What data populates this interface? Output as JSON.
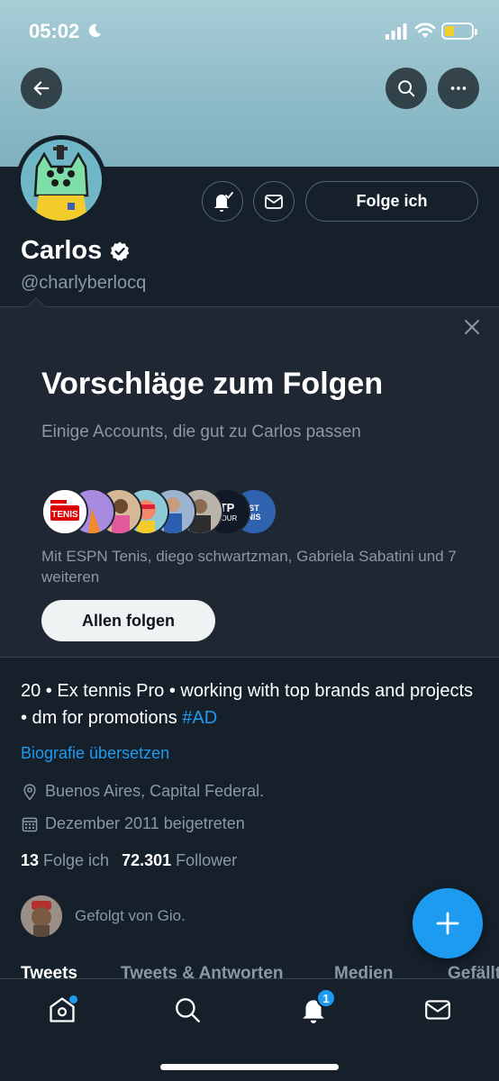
{
  "status_bar": {
    "time": "05:02",
    "icons": [
      "moon-icon",
      "signal-icon",
      "wifi-icon",
      "battery-icon"
    ],
    "battery_level": 0.35
  },
  "header": {
    "icons": [
      "back-arrow-icon",
      "search-icon",
      "more-icon"
    ]
  },
  "profile": {
    "name": "Carlos",
    "handle": "@charlyberlocq",
    "follow_label": "Folge ich",
    "icons": [
      "bell-check-icon",
      "mail-icon",
      "verified-icon"
    ]
  },
  "suggestions": {
    "title": "Vorschläge zum Folgen",
    "subtitle": "Einige Accounts, die gut zu Carlos passen",
    "avatars_text": "Mit ESPN Tenis, diego schwartzman, Gabriela Sabatini und 7 weiteren",
    "follow_all_label": "Allen folgen",
    "espn_logo_text": "TENIS",
    "atp_logo_text": "TOUR"
  },
  "bio": {
    "text": "20 • Ex tennis Pro • working with top brands and projects • dm for promotions ",
    "hashtag": "#AD",
    "translate_label": "Biografie übersetzen",
    "location": "Buenos Aires, Capital Federal.",
    "joined": "Dezember 2011 beigetreten"
  },
  "counts": {
    "following_count": "13",
    "following_label": "Folge ich",
    "followers_count": "72.301",
    "followers_label": "Follower"
  },
  "followed_by": {
    "text": "Gefolgt von Gio."
  },
  "tabs": [
    {
      "label": "Tweets",
      "active": true
    },
    {
      "label": "Tweets & Antworten",
      "active": false
    },
    {
      "label": "Medien",
      "active": false
    },
    {
      "label": "Gefällt mir",
      "active": false
    }
  ],
  "bottom_nav": {
    "items": [
      "home-icon",
      "search-icon",
      "notifications-icon",
      "messages-icon"
    ],
    "notification_badge": "1"
  },
  "colors": {
    "background": "#15202b",
    "accent": "#1d9bf0",
    "secondary_text": "#8b98a5"
  }
}
